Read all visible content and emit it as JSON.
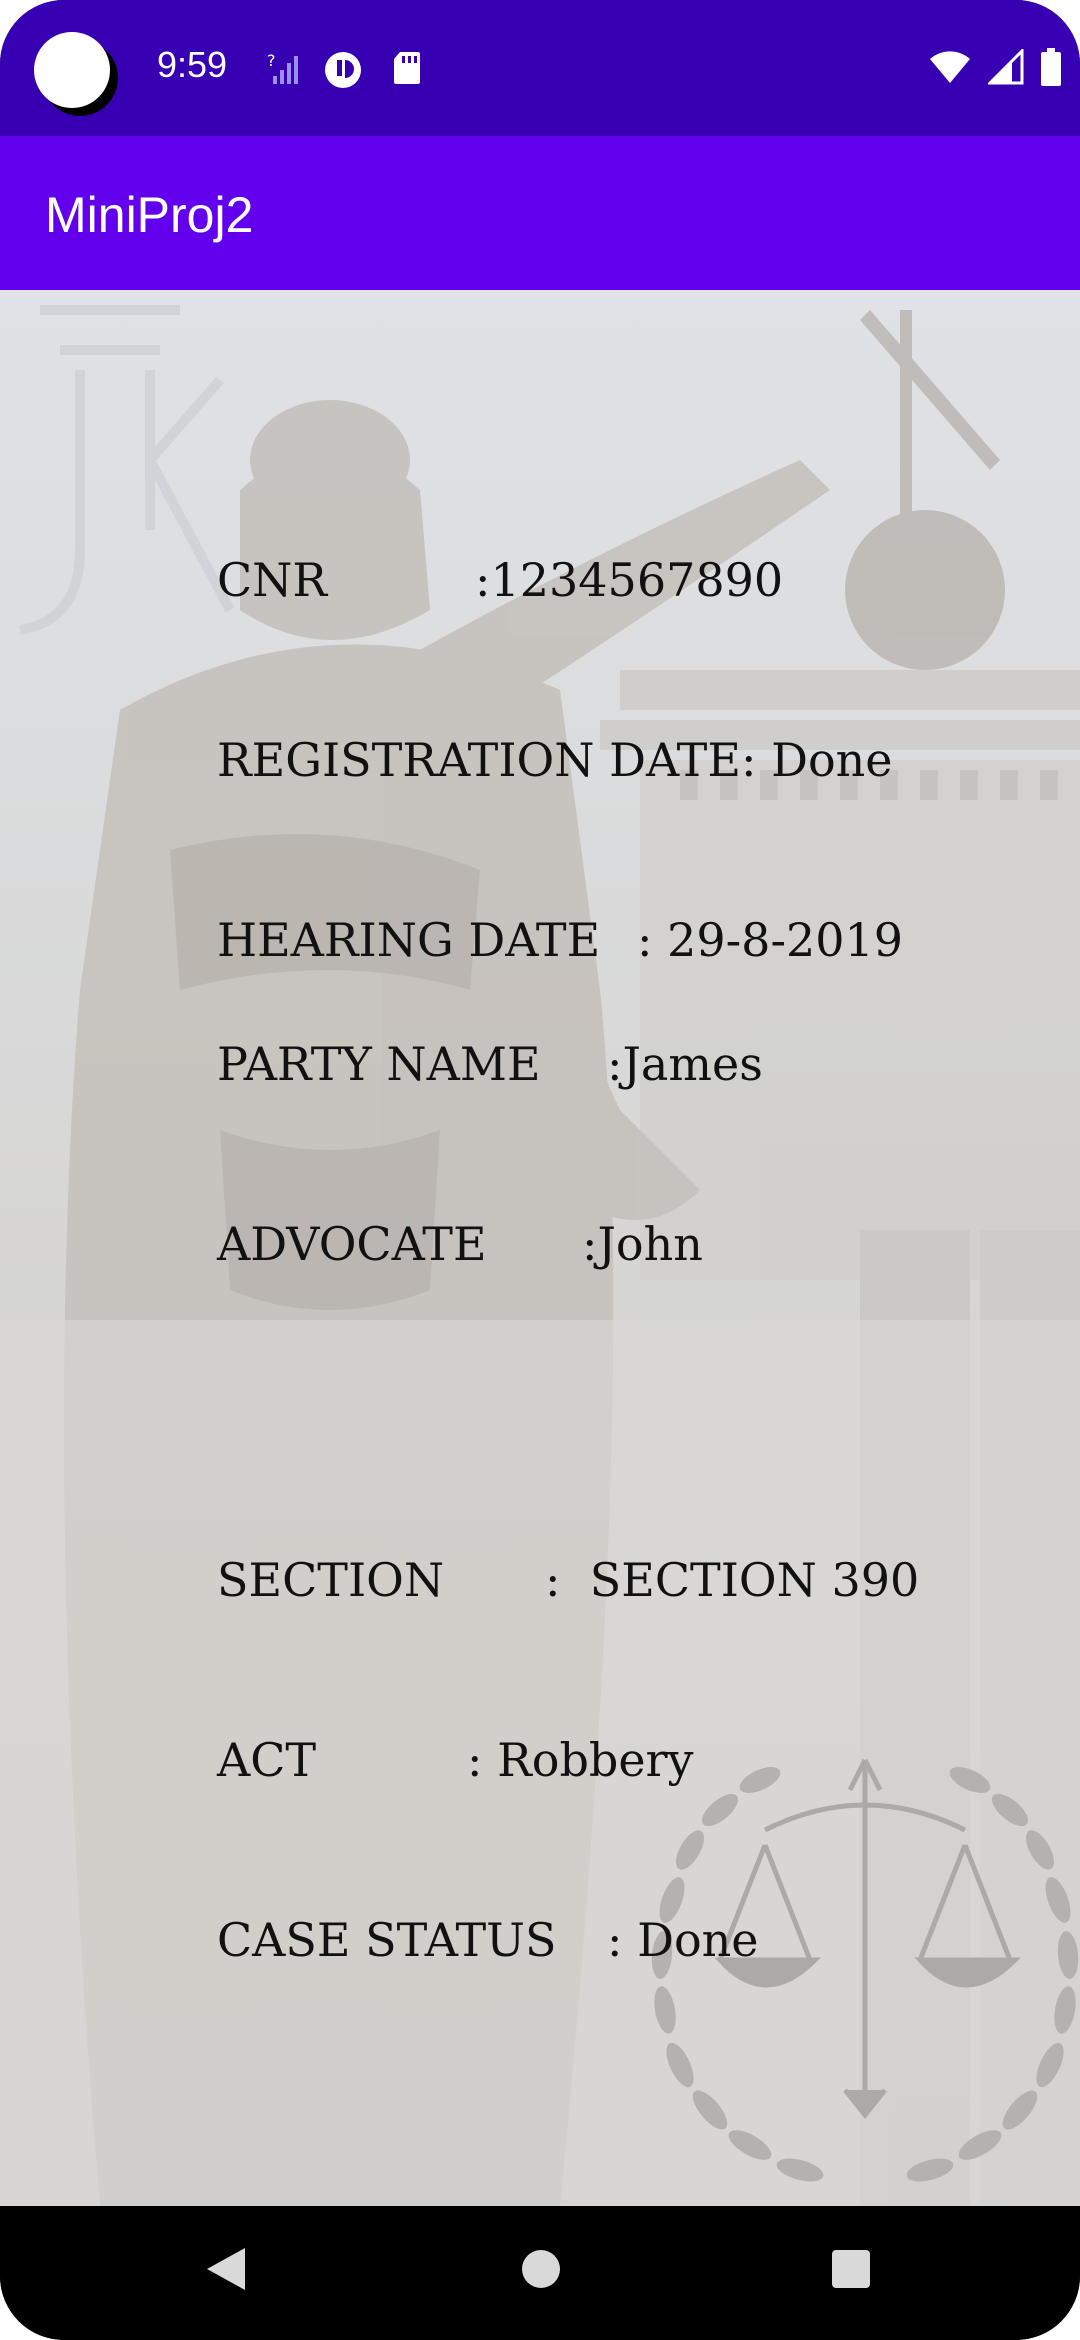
{
  "status_bar": {
    "time": "9:59",
    "icons": [
      "camera-cutout",
      "signal-unknown-icon",
      "data-saver-icon",
      "sd-card-icon",
      "wifi-icon",
      "cell-signal-icon",
      "battery-icon"
    ]
  },
  "app_bar": {
    "title": "MiniProj2"
  },
  "case_info": {
    "cnr": {
      "label": "CNR",
      "sep": ":",
      "value": "1234567890"
    },
    "registration_date": {
      "label": "REGISTRATION DATE",
      "sep": ":",
      "value": "Done"
    },
    "hearing_date": {
      "label": "HEARING DATE",
      "sep": ":",
      "value": "29-8-2019"
    },
    "party_name": {
      "label": "PARTY NAME",
      "sep": ":",
      "value": "James"
    },
    "advocate": {
      "label": "ADVOCATE",
      "sep": ":",
      "value": "John"
    },
    "section": {
      "label": "SECTION",
      "sep": ":",
      "value": "SECTION 390"
    },
    "act": {
      "label": "ACT",
      "sep": ":",
      "value": "Robbery"
    },
    "case_status": {
      "label": "CASE STATUS",
      "sep": ":",
      "value": "Done"
    }
  },
  "background": {
    "description_icon": "justice-statue-background",
    "emblem_icon": "scales-of-justice-emblem"
  },
  "nav_bar": {
    "icons": [
      "back-icon",
      "home-icon",
      "recents-icon"
    ]
  },
  "colors": {
    "status_bar": "#3700b3",
    "app_bar": "#6200ee",
    "content_bg": "#d9d8d5",
    "text": "#111111"
  }
}
